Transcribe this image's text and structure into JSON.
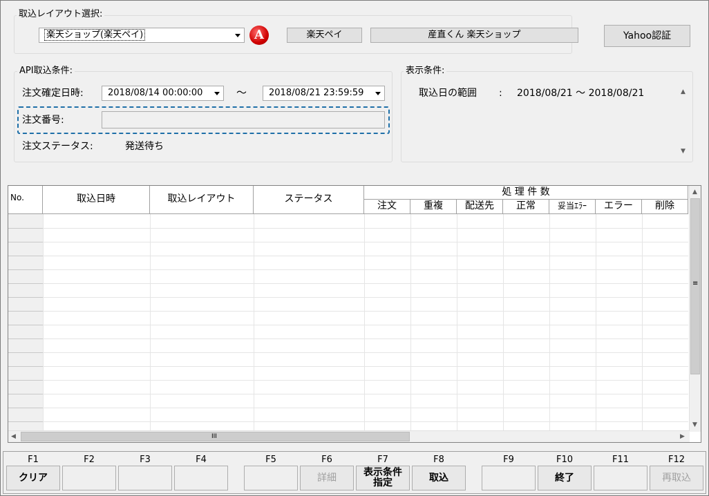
{
  "layout_select": {
    "group_label": "取込レイアウト選択:",
    "selected": "楽天ショップ(楽天ペイ)",
    "badge": "A",
    "btn_rakuten_pay": "楽天ペイ",
    "btn_shop": "産直くん 楽天ショップ",
    "btn_yahoo": "Yahoo認証"
  },
  "api_conditions": {
    "group_label": "API取込条件:",
    "confirm_label": "注文確定日時:",
    "date_from": "2018/08/14 00:00:00",
    "tilde": "〜",
    "date_to": "2018/08/21 23:59:59",
    "order_no_label": "注文番号:",
    "order_no_value": "",
    "status_label": "注文ステータス:",
    "status_value": "発送待ち"
  },
  "display_conditions": {
    "group_label": "表示条件:",
    "range_label": "取込日の範囲",
    "colon": ":",
    "range_value": "2018/08/21 〜 2018/08/21"
  },
  "grid": {
    "col_no": "No.",
    "col_datetime": "取込日時",
    "col_layout": "取込レイアウト",
    "col_status": "ステータス",
    "group_header": "処 理 件 数",
    "sub_cols": [
      "注文",
      "重複",
      "配送先",
      "正常",
      "妥当ｴﾗｰ",
      "エラー",
      "削除"
    ],
    "hscroll_thumb": "III",
    "vscroll_thumb": "≡"
  },
  "function_keys": [
    {
      "key": "F1",
      "label": "クリア",
      "state": "enabled"
    },
    {
      "key": "F2",
      "label": "",
      "state": "empty"
    },
    {
      "key": "F3",
      "label": "",
      "state": "empty"
    },
    {
      "key": "F4",
      "label": "",
      "state": "empty"
    },
    {
      "key": "F5",
      "label": "",
      "state": "empty"
    },
    {
      "key": "F6",
      "label": "詳細",
      "state": "disabled"
    },
    {
      "key": "F7",
      "label": "表示条件\n指定",
      "state": "enabled"
    },
    {
      "key": "F8",
      "label": "取込",
      "state": "enabled"
    },
    {
      "key": "F9",
      "label": "",
      "state": "empty"
    },
    {
      "key": "F10",
      "label": "終了",
      "state": "enabled"
    },
    {
      "key": "F11",
      "label": "",
      "state": "empty"
    },
    {
      "key": "F12",
      "label": "再取込",
      "state": "disabled"
    }
  ],
  "colors": {
    "dashed_focus": "#1e6fa8",
    "badge_red": "#d00000"
  }
}
